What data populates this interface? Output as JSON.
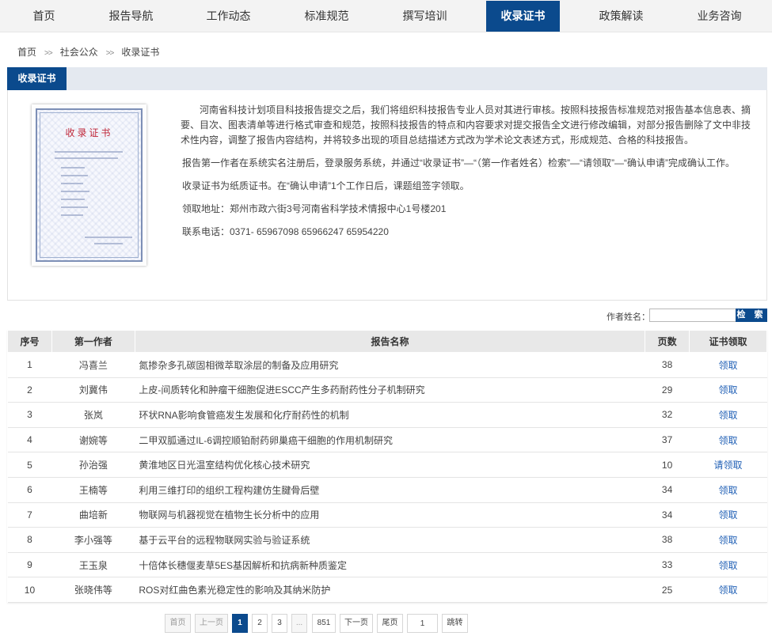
{
  "nav": {
    "items": [
      "首页",
      "报告导航",
      "工作动态",
      "标准规范",
      "撰写培训",
      "收录证书",
      "政策解读",
      "业务咨询"
    ],
    "active_index": 5
  },
  "breadcrumb": {
    "items": [
      "首页",
      "社会公众",
      "收录证书"
    ],
    "separator": ">>"
  },
  "section": {
    "tab_label": "收录证书",
    "certificate_title": "收录证书",
    "paragraphs": [
      "河南省科技计划项目科技报告提交之后，我们将组织科技报告专业人员对其进行审核。按照科技报告标准规范对报告基本信息表、摘要、目次、图表清单等进行格式审查和规范，按照科技报告的特点和内容要求对提交报告全文进行修改编辑，对部分报告删除了文中非技术性内容，调整了报告内容结构，并将较多出现的项目总结描述方式改为学术论文表述方式，形成规范、合格的科技报告。",
      "报告第一作者在系统实名注册后，登录服务系统，并通过“收录证书”—“（第一作者姓名）检索”—“请领取”—“确认申请”完成确认工作。",
      "收录证书为纸质证书。在“确认申请”1个工作日后，课题组签字领取。",
      "领取地址：郑州市政六街3号河南省科学技术情报中心1号楼201",
      "联系电话：0371- 65967098 65966247 65954220"
    ]
  },
  "search": {
    "label": "作者姓名：",
    "value": "",
    "placeholder": "",
    "button_label": "检 索"
  },
  "table": {
    "headers": [
      "序号",
      "第一作者",
      "报告名称",
      "页数",
      "证书领取"
    ],
    "rows": [
      {
        "no": "1",
        "author": "冯喜兰",
        "title": "氮掺杂多孔碳固相微萃取涂层的制备及应用研究",
        "pages": "38",
        "action": "领取"
      },
      {
        "no": "2",
        "author": "刘冀伟",
        "title": "上皮-间质转化和肿瘤干细胞促进ESCC产生多药耐药性分子机制研究",
        "pages": "29",
        "action": "领取"
      },
      {
        "no": "3",
        "author": "张岚",
        "title": "环状RNA影响食管癌发生发展和化疗耐药性的机制",
        "pages": "32",
        "action": "领取"
      },
      {
        "no": "4",
        "author": "谢婉等",
        "title": "二甲双胍通过IL-6调控顺铂耐药卵巢癌干细胞的作用机制研究",
        "pages": "37",
        "action": "领取"
      },
      {
        "no": "5",
        "author": "孙治强",
        "title": "黄淮地区日光温室结构优化核心技术研究",
        "pages": "10",
        "action": "请领取"
      },
      {
        "no": "6",
        "author": "王楠等",
        "title": "利用三维打印的组织工程构建仿生腱骨后壁",
        "pages": "34",
        "action": "领取"
      },
      {
        "no": "7",
        "author": "曲培新",
        "title": "物联网与机器视觉在植物生长分析中的应用",
        "pages": "34",
        "action": "领取"
      },
      {
        "no": "8",
        "author": "李小强等",
        "title": "基于云平台的远程物联网实验与验证系统",
        "pages": "38",
        "action": "领取"
      },
      {
        "no": "9",
        "author": "王玉泉",
        "title": "十倍体长穗偃麦草5ES基因解析和抗病新种质鉴定",
        "pages": "33",
        "action": "领取"
      },
      {
        "no": "10",
        "author": "张晓伟等",
        "title": "ROS对红曲色素光稳定性的影响及其纳米防护",
        "pages": "25",
        "action": "领取"
      }
    ]
  },
  "pagination": {
    "first": "首页",
    "prev": "上一页",
    "pages": [
      "1",
      "2",
      "3"
    ],
    "ellipsis": "...",
    "last_page": "851",
    "next": "下一页",
    "last": "尾页",
    "jump_value": "1",
    "jump_label": "跳转",
    "current_page": 1
  },
  "colors": {
    "accent": "#0b4a8d",
    "link": "#1f5fb5"
  }
}
